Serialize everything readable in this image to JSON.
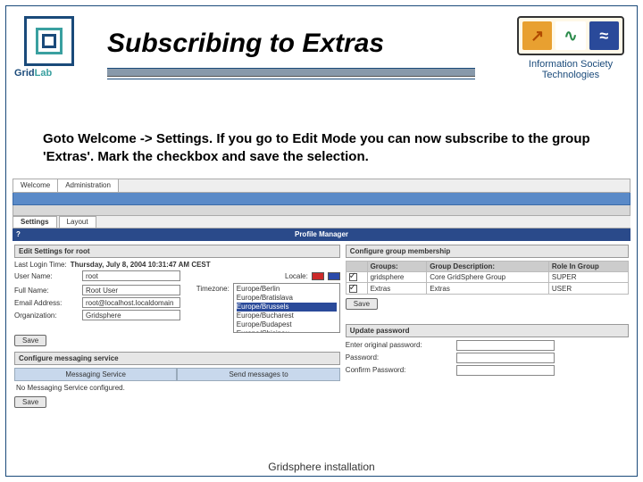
{
  "header": {
    "logo_left": {
      "text_a": "Grid",
      "text_b": "Lab"
    },
    "title": "Subscribing to Extras",
    "logo_right": {
      "glyph1": "↗",
      "glyph2": "∿",
      "glyph3": "≈",
      "line1": "Information Society",
      "line2": "Technologies"
    }
  },
  "instructions": "Goto Welcome -> Settings. If you go to Edit Mode you can now subscribe to the group 'Extras'. Mark the checkbox and save the selection.",
  "screenshot": {
    "outer_tabs": [
      "Welcome",
      "Administration"
    ],
    "inner_tabs": [
      "Settings",
      "Layout"
    ],
    "pm_title": "Profile Manager",
    "pm_q": "?",
    "edit_settings": {
      "heading": "Edit Settings for root",
      "last_login_label": "Last Login Time:",
      "last_login_value": "Thursday, July 8, 2004 10:31:47 AM CEST",
      "username_label": "User Name:",
      "username_value": "root",
      "locale_label": "Locale:",
      "fullname_label": "Full Name:",
      "fullname_value": "Root User",
      "email_label": "Email Address:",
      "email_value": "root@localhost.localdomain",
      "org_label": "Organization:",
      "org_value": "Gridsphere",
      "timezone_label": "Timezone:",
      "timezones": [
        "Europe/Berlin",
        "Europe/Bratislava",
        "Europe/Brussels",
        "Europe/Bucharest",
        "Europe/Budapest",
        "Europe/Chisinau"
      ],
      "save": "Save"
    },
    "group_membership": {
      "heading": "Configure group membership",
      "cols": [
        "",
        "Groups:",
        "Group Description:",
        "Role In Group"
      ],
      "rows": [
        {
          "checked": true,
          "group": "gridsphere",
          "desc": "Core GridSphere Group",
          "role": "SUPER"
        },
        {
          "checked": true,
          "group": "Extras",
          "desc": "Extras",
          "role": "USER"
        }
      ],
      "save": "Save"
    },
    "messaging": {
      "heading": "Configure messaging service",
      "col1": "Messaging Service",
      "col2": "Send messages to",
      "none": "No Messaging Service configured.",
      "save": "Save"
    },
    "password": {
      "heading": "Update password",
      "orig": "Enter original password:",
      "new": "Password:",
      "confirm": "Confirm Password:"
    }
  },
  "footer": "Gridsphere installation"
}
